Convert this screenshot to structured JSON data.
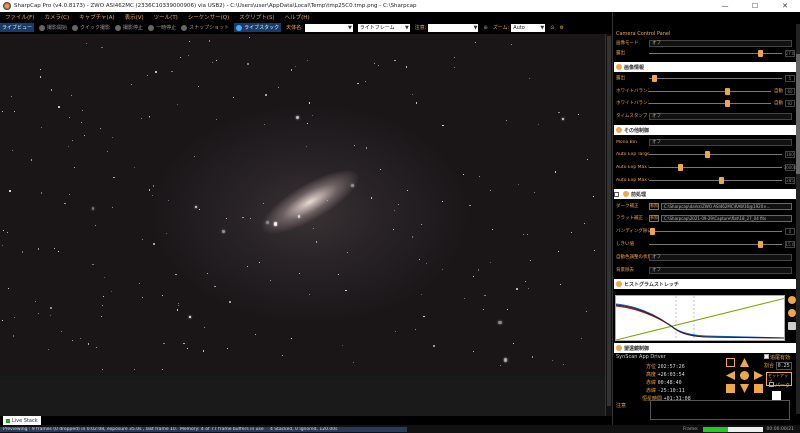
{
  "window": {
    "title": "SharpCap Pro (v4.0.8173) - ZWO ASI462MC (2336C10339000906) via USB2) - C:\\Users\\user\\AppData\\Local\\Temp\\tmp25C0.tmp.png - C:\\Sharpcap",
    "minimize": "—",
    "maximize": "☐",
    "close": "✕"
  },
  "menu": [
    "ファイル(F)",
    "カメラ(C)",
    "キャプチャ(A)",
    "表示(V)",
    "ツール(T)",
    "シーケンサー(Q)",
    "スクリプト(S)",
    "ヘルプ(H)"
  ],
  "toolbar": {
    "live_view": "ライブビュー",
    "start_capture": "撮影開始",
    "quick_capture": "クイック撮影",
    "stop_capture": "撮影停止",
    "pause": "一時停止",
    "snapshot": "スナップショット",
    "live_stack": "ライブスタック",
    "target_label": "天体名:",
    "target_value": "",
    "frame_type": "ライトフレーム",
    "notes_label": "注意:",
    "notes_value": "",
    "zoom_label": "ズーム:",
    "zoom_value": "Auto"
  },
  "panel": {
    "title": "Camera Control Panel",
    "rows": {
      "cap_mode": {
        "label": "画像モード",
        "value": "オフ"
      },
      "gain": {
        "label": "露出",
        "value": "27.0"
      },
      "section_image": "画像情報",
      "exposure": {
        "label": "露出",
        "value": "5"
      },
      "wb_red": {
        "label": "ホワイトバランス(R)",
        "auto": "自動",
        "value": "60"
      },
      "wb_blue": {
        "label": "ホワイトバランス(B)",
        "auto": "自動",
        "value": "92"
      },
      "timestamp": {
        "label": "タイムスタンプ",
        "value": "オフ"
      },
      "section_misc": "その他制御",
      "mono_bin": {
        "label": "Mono Bin",
        "value": "オフ"
      },
      "auto_exp_target": {
        "label": "Auto Exp Target Brightness",
        "value": "100"
      },
      "auto_exp_max": {
        "label": "Auto Exp Max Exp M S",
        "value": "30000"
      },
      "auto_exp_max_gain": {
        "label": "Auto Exp Max Gain",
        "value": "285"
      },
      "section_pre": "前処理",
      "dark": {
        "label": "ダーク補正",
        "btn": "参照",
        "path": "C:\\Sharpcap\\darks\\ZWO ASI462MC\\RAW16@1920×..."
      },
      "flat": {
        "label": "フラット補正",
        "btn": "参照",
        "path": "C:\\Sharpcap\\2021-09-29\\Capture\\flat\\18_27_04 fits"
      },
      "banding": {
        "label": "バンディング除去",
        "value": "0"
      },
      "threshold": {
        "label": "しきい値",
        "value": "15.0"
      },
      "auto_adjust": {
        "label": "自動色調整の状態(適用)",
        "value": "オフ"
      },
      "filter": {
        "label": "背景除去",
        "value": "オフ"
      },
      "section_histo": "ヒストグラムストレッチ",
      "section_mount": "望遠鏡制御"
    },
    "mount": {
      "name": "SynScan App Driver",
      "track_label": "追尾",
      "track": "追尾有効",
      "rate_label": "割合",
      "rate_value": "0.25",
      "ra_label": "方位",
      "ra": "202:57:26",
      "alt_label": "高度",
      "alt": "+26:03:54",
      "dec_label": "赤緯",
      "dec": "00:48:40",
      "dec2_label": "赤緯",
      "dec2": "-25:10:11",
      "lst_label": "恒星時間",
      "lst": "+01:31:08",
      "setup": "セットアップ",
      "park": "パーク",
      "notes_label": "注意"
    }
  },
  "live_stack_tab": "Live Stack",
  "status": {
    "s1": "Previewing : 9 frames (0 dropped) in 0:02:08, exposure 35.0s , last frame 10.2s",
    "s2": "Memory: 4 of 77 frame buffers in use",
    "s3": "4 Stacked, 0 Ignored, 120.00s",
    "s4": "",
    "frame_label": "Frame:",
    "frame_text": "00:00:00/21",
    "frame_progress": 0.42
  }
}
